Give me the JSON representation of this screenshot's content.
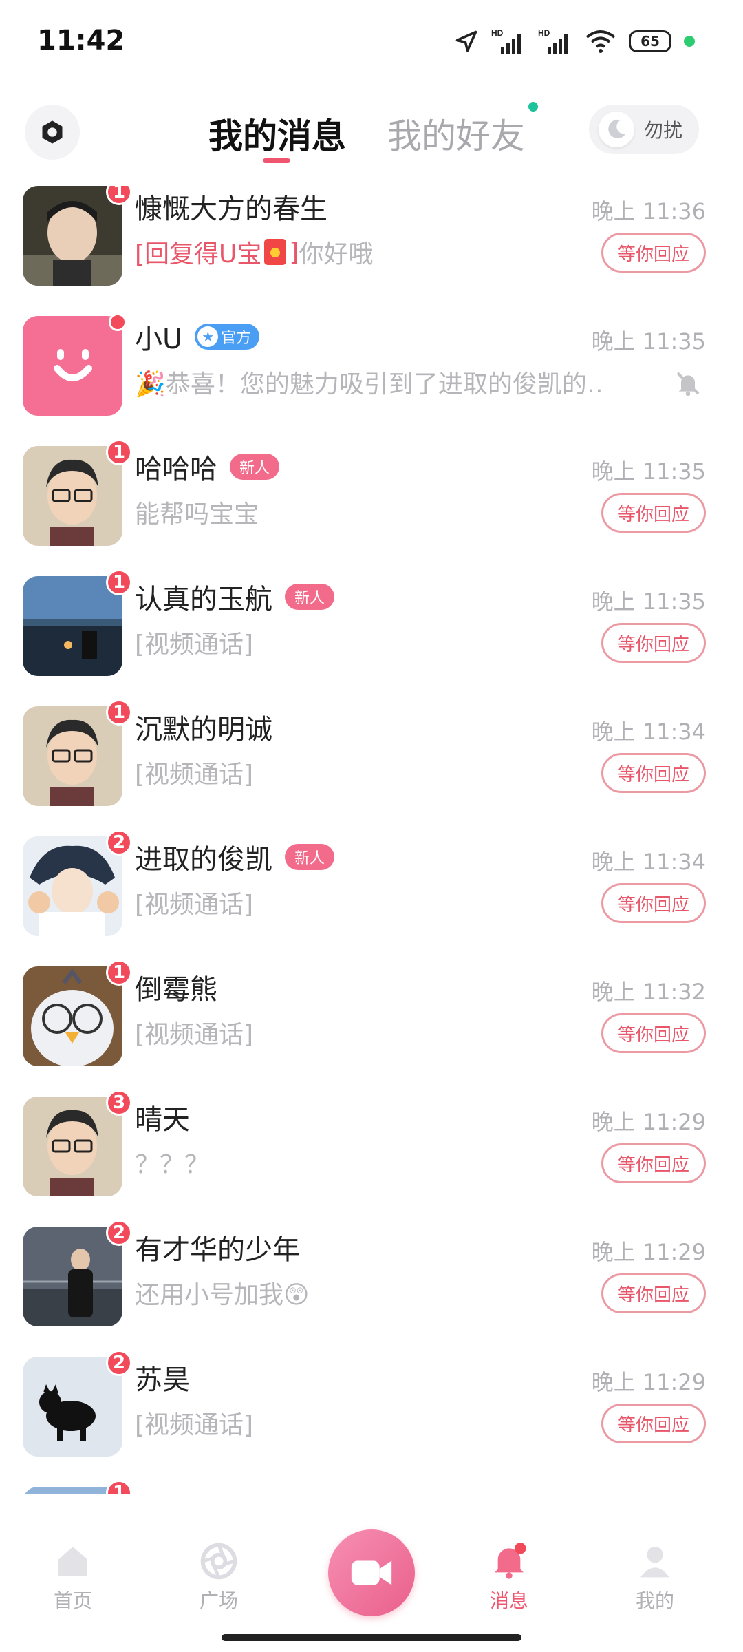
{
  "status_bar": {
    "time": "11:42",
    "battery": "65"
  },
  "header": {
    "tab_active": "我的消息",
    "tab_inactive": "我的好友",
    "dnd_label": "勿扰"
  },
  "conversations": [
    {
      "name": "慷慨大方的春生",
      "time": "晚上 11:36",
      "preview_highlight_open": "[回复得U宝",
      "preview_highlight_close": "]",
      "preview_rest": "你好哦",
      "badge": "1",
      "action": "等你回应"
    },
    {
      "name": "小U",
      "official": "官方",
      "time": "晚上 11:35",
      "preview": "🎉恭喜！您的魅力吸引到了进取的俊凯的‥",
      "action": ""
    },
    {
      "name": "哈哈哈",
      "new_tag": "新人",
      "time": "晚上 11:35",
      "preview": "能帮吗宝宝",
      "badge": "1",
      "action": "等你回应"
    },
    {
      "name": "认真的玉航",
      "new_tag": "新人",
      "time": "晚上 11:35",
      "preview": "[视频通话]",
      "badge": "1",
      "action": "等你回应"
    },
    {
      "name": "沉默的明诚",
      "time": "晚上 11:34",
      "preview": "[视频通话]",
      "badge": "1",
      "action": "等你回应"
    },
    {
      "name": "进取的俊凯",
      "new_tag": "新人",
      "time": "晚上 11:34",
      "preview": "[视频通话]",
      "badge": "2",
      "action": "等你回应"
    },
    {
      "name": "倒霉熊",
      "time": "晚上 11:32",
      "preview": "[视频通话]",
      "badge": "1",
      "action": "等你回应"
    },
    {
      "name": "晴天",
      "time": "晚上 11:29",
      "preview": "？？？",
      "badge": "3",
      "action": "等你回应"
    },
    {
      "name": "有才华的少年",
      "time": "晚上 11:29",
      "preview": "还用小号加我😲",
      "badge": "2",
      "action": "等你回应"
    },
    {
      "name": "苏昊",
      "time": "晚上 11:29",
      "preview": "[视频通话]",
      "badge": "2",
      "action": "等你回应"
    },
    {
      "badge": "1"
    }
  ],
  "bottom_nav": {
    "home": "首页",
    "square": "广场",
    "messages": "消息",
    "mine": "我的"
  },
  "colors": {
    "accent": "#f0556f",
    "badge": "#f24a5a",
    "new_tag": "#f26b8a",
    "official": "#4a9ff5"
  },
  "icons": [
    "location-arrow-icon",
    "signal-icon",
    "wifi-icon",
    "battery-icon",
    "settings-icon",
    "moon-icon",
    "mute-icon",
    "home-icon",
    "square-icon",
    "video-call-icon",
    "bell-icon",
    "user-icon"
  ]
}
